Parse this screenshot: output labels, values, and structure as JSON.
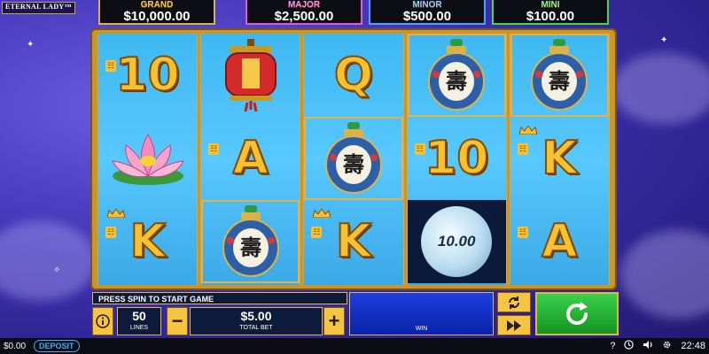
{
  "game": {
    "logo": "ETERNAL LADY™"
  },
  "jackpots": [
    {
      "label": "GRAND",
      "value": "$10,000.00"
    },
    {
      "label": "MAJOR",
      "value": "$2,500.00"
    },
    {
      "label": "MINOR",
      "value": "$500.00"
    },
    {
      "label": "MINI",
      "value": "$100.00"
    }
  ],
  "reels": [
    [
      "10",
      "lotus",
      "K"
    ],
    [
      "lantern",
      "A",
      "snuff-bottle"
    ],
    [
      "Q",
      "snuff-bottle",
      "K"
    ],
    [
      "snuff-bottle",
      "10",
      "moon"
    ],
    [
      "snuff-bottle",
      "K",
      "A"
    ]
  ],
  "moon_value": "10.00",
  "panel": {
    "message": "PRESS SPIN TO START GAME",
    "lines_value": "50",
    "lines_label": "LINES",
    "minus": "−",
    "plus": "+",
    "bet_value": "$5.00",
    "bet_label": "TOTAL BET",
    "win_label": "WIN"
  },
  "status": {
    "balance": "$0.00",
    "deposit": "DEPOSIT",
    "help": "?",
    "time": "22:48"
  },
  "colors": {
    "spin": "#1fb52c",
    "gold": "#f3c540",
    "win_panel": "#1c3fe0"
  }
}
